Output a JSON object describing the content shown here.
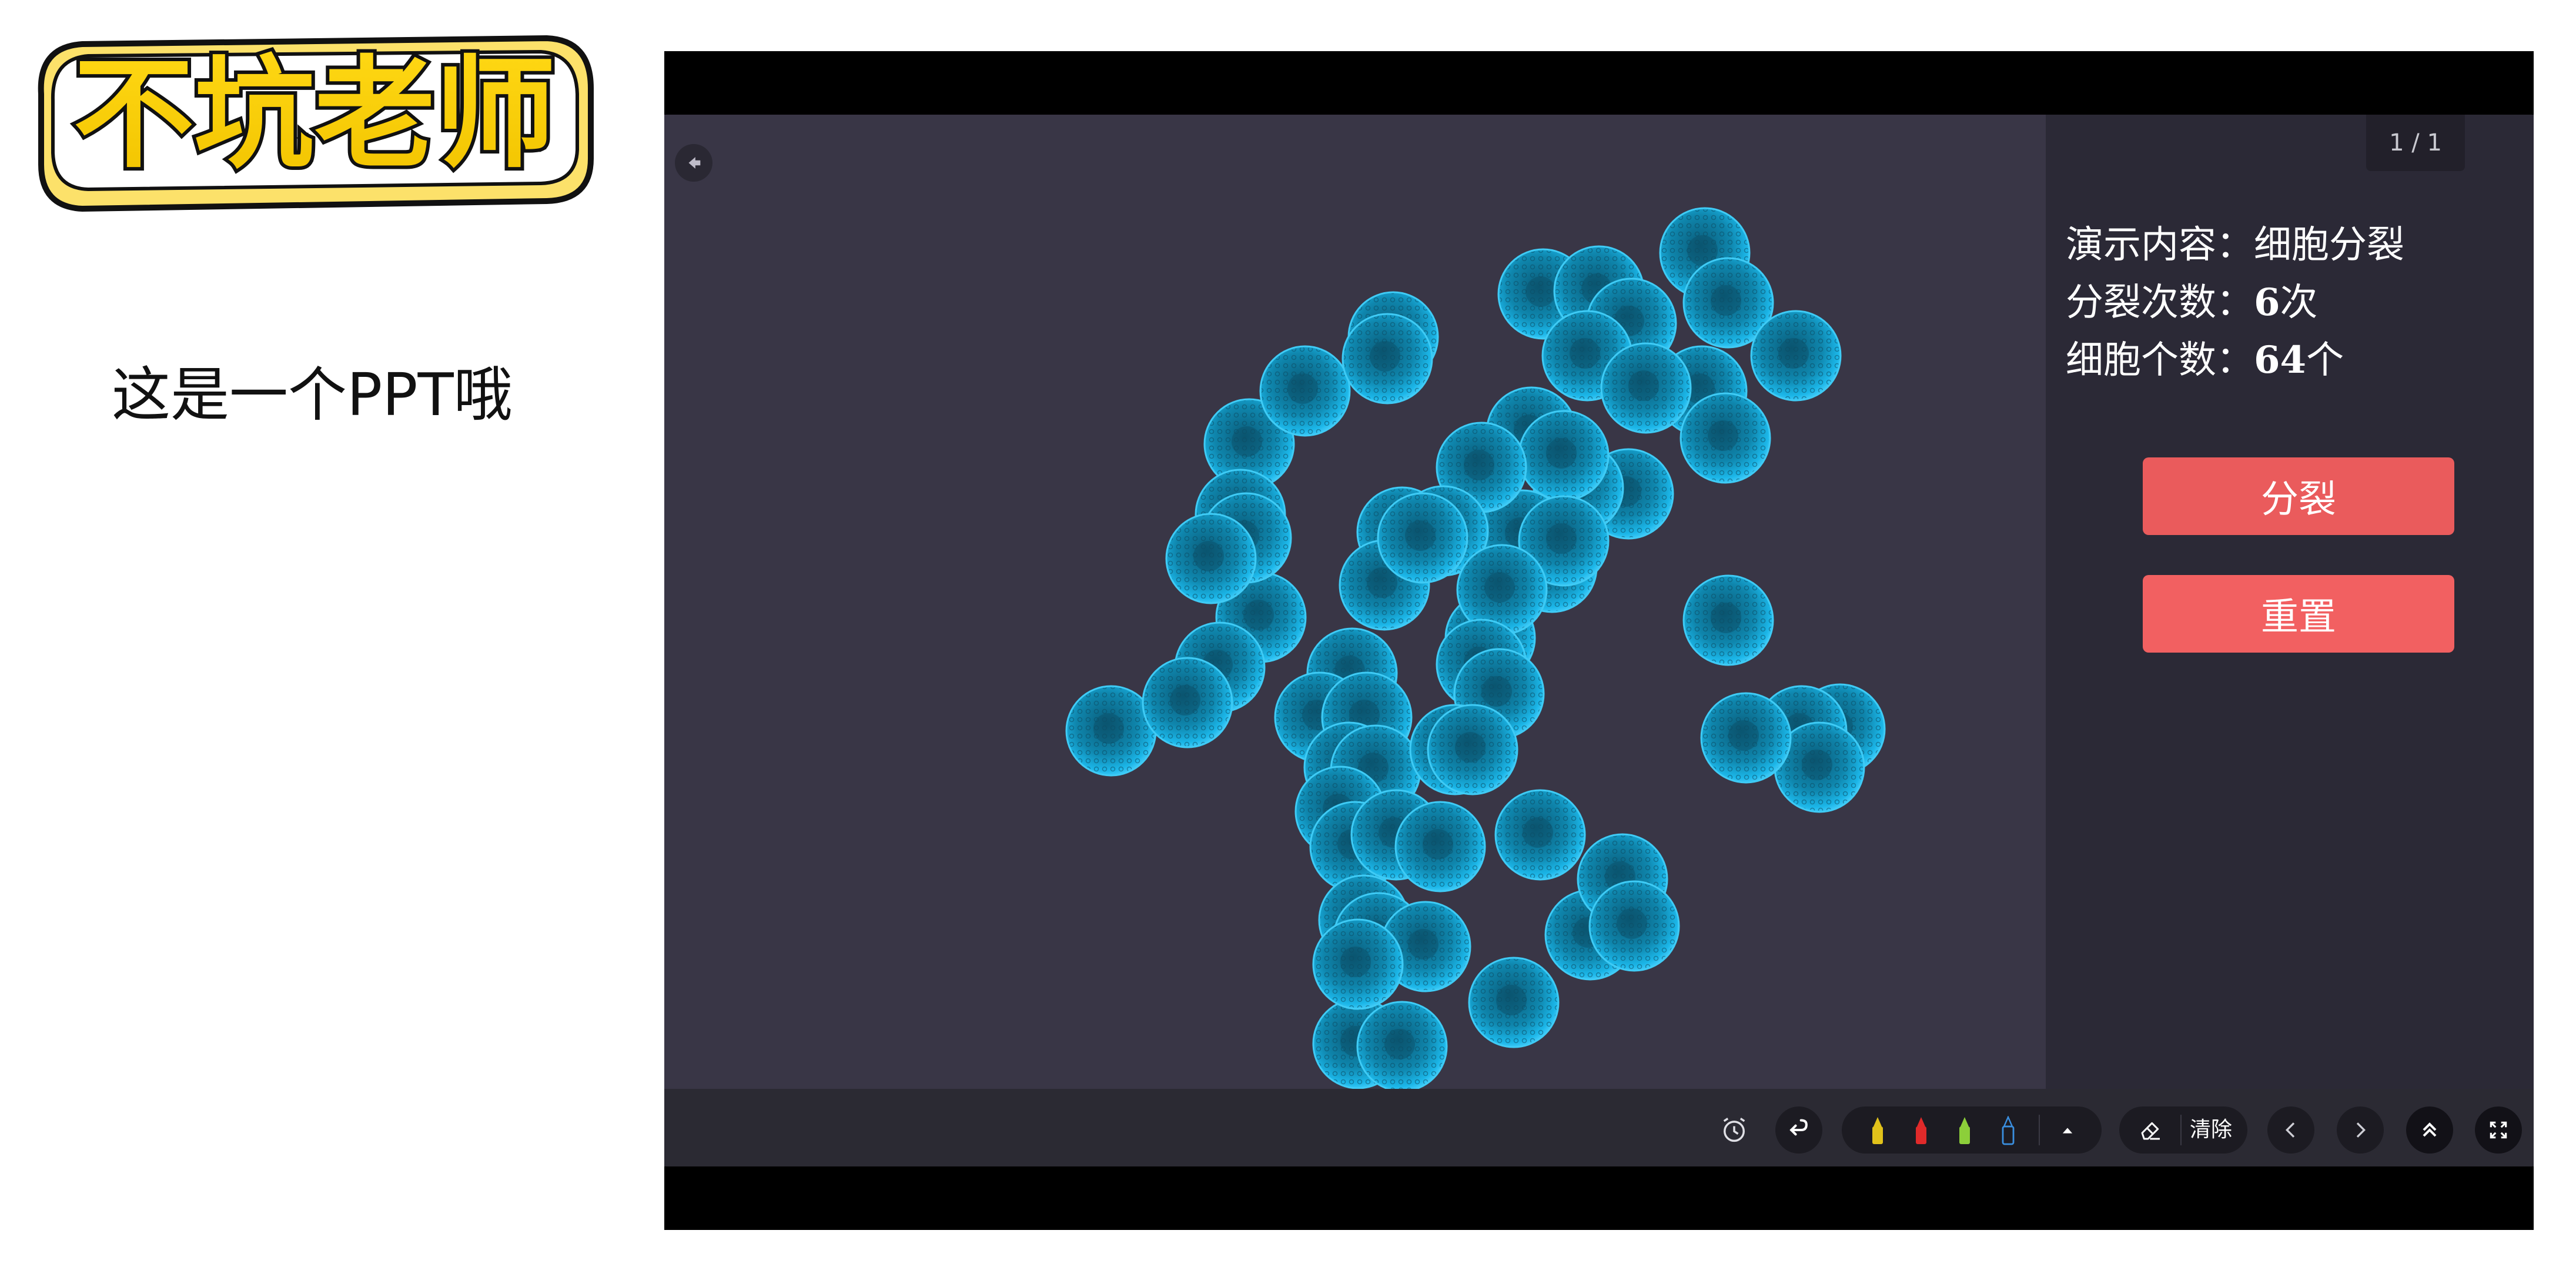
{
  "left": {
    "logo_text": "不坑老师",
    "subtitle": "这是一个PPT哦"
  },
  "player": {
    "page_indicator": "1 / 1",
    "info": {
      "content_label": "演示内容：",
      "content_value": "细胞分裂",
      "count_label": "分裂次数：",
      "count_number": "6",
      "count_unit": "次",
      "cells_label": "细胞个数：",
      "cells_number": "64",
      "cells_unit": "个"
    },
    "buttons": {
      "divide": "分裂",
      "reset": "重置"
    },
    "toolbar": {
      "clear_label": "清除",
      "icons": [
        "alarm-clock-icon",
        "undo-icon",
        "yellow-pen-icon",
        "red-pen-icon",
        "green-pen-icon",
        "blue-pen-icon",
        "caret-up-icon",
        "eraser-icon",
        "chevron-left-icon",
        "chevron-right-icon",
        "double-chevron-up-icon",
        "fullscreen-icon"
      ],
      "pen_colors": [
        "#e1c21a",
        "#e02a2a",
        "#8ccf3a",
        "#3a8fe0"
      ]
    },
    "colors": {
      "stage_bg": "#393646",
      "panel_bg": "#2b2936",
      "cell": "#1bb6e8",
      "divide_button": "#ea5b5c",
      "reset_button": "#f26061"
    }
  }
}
